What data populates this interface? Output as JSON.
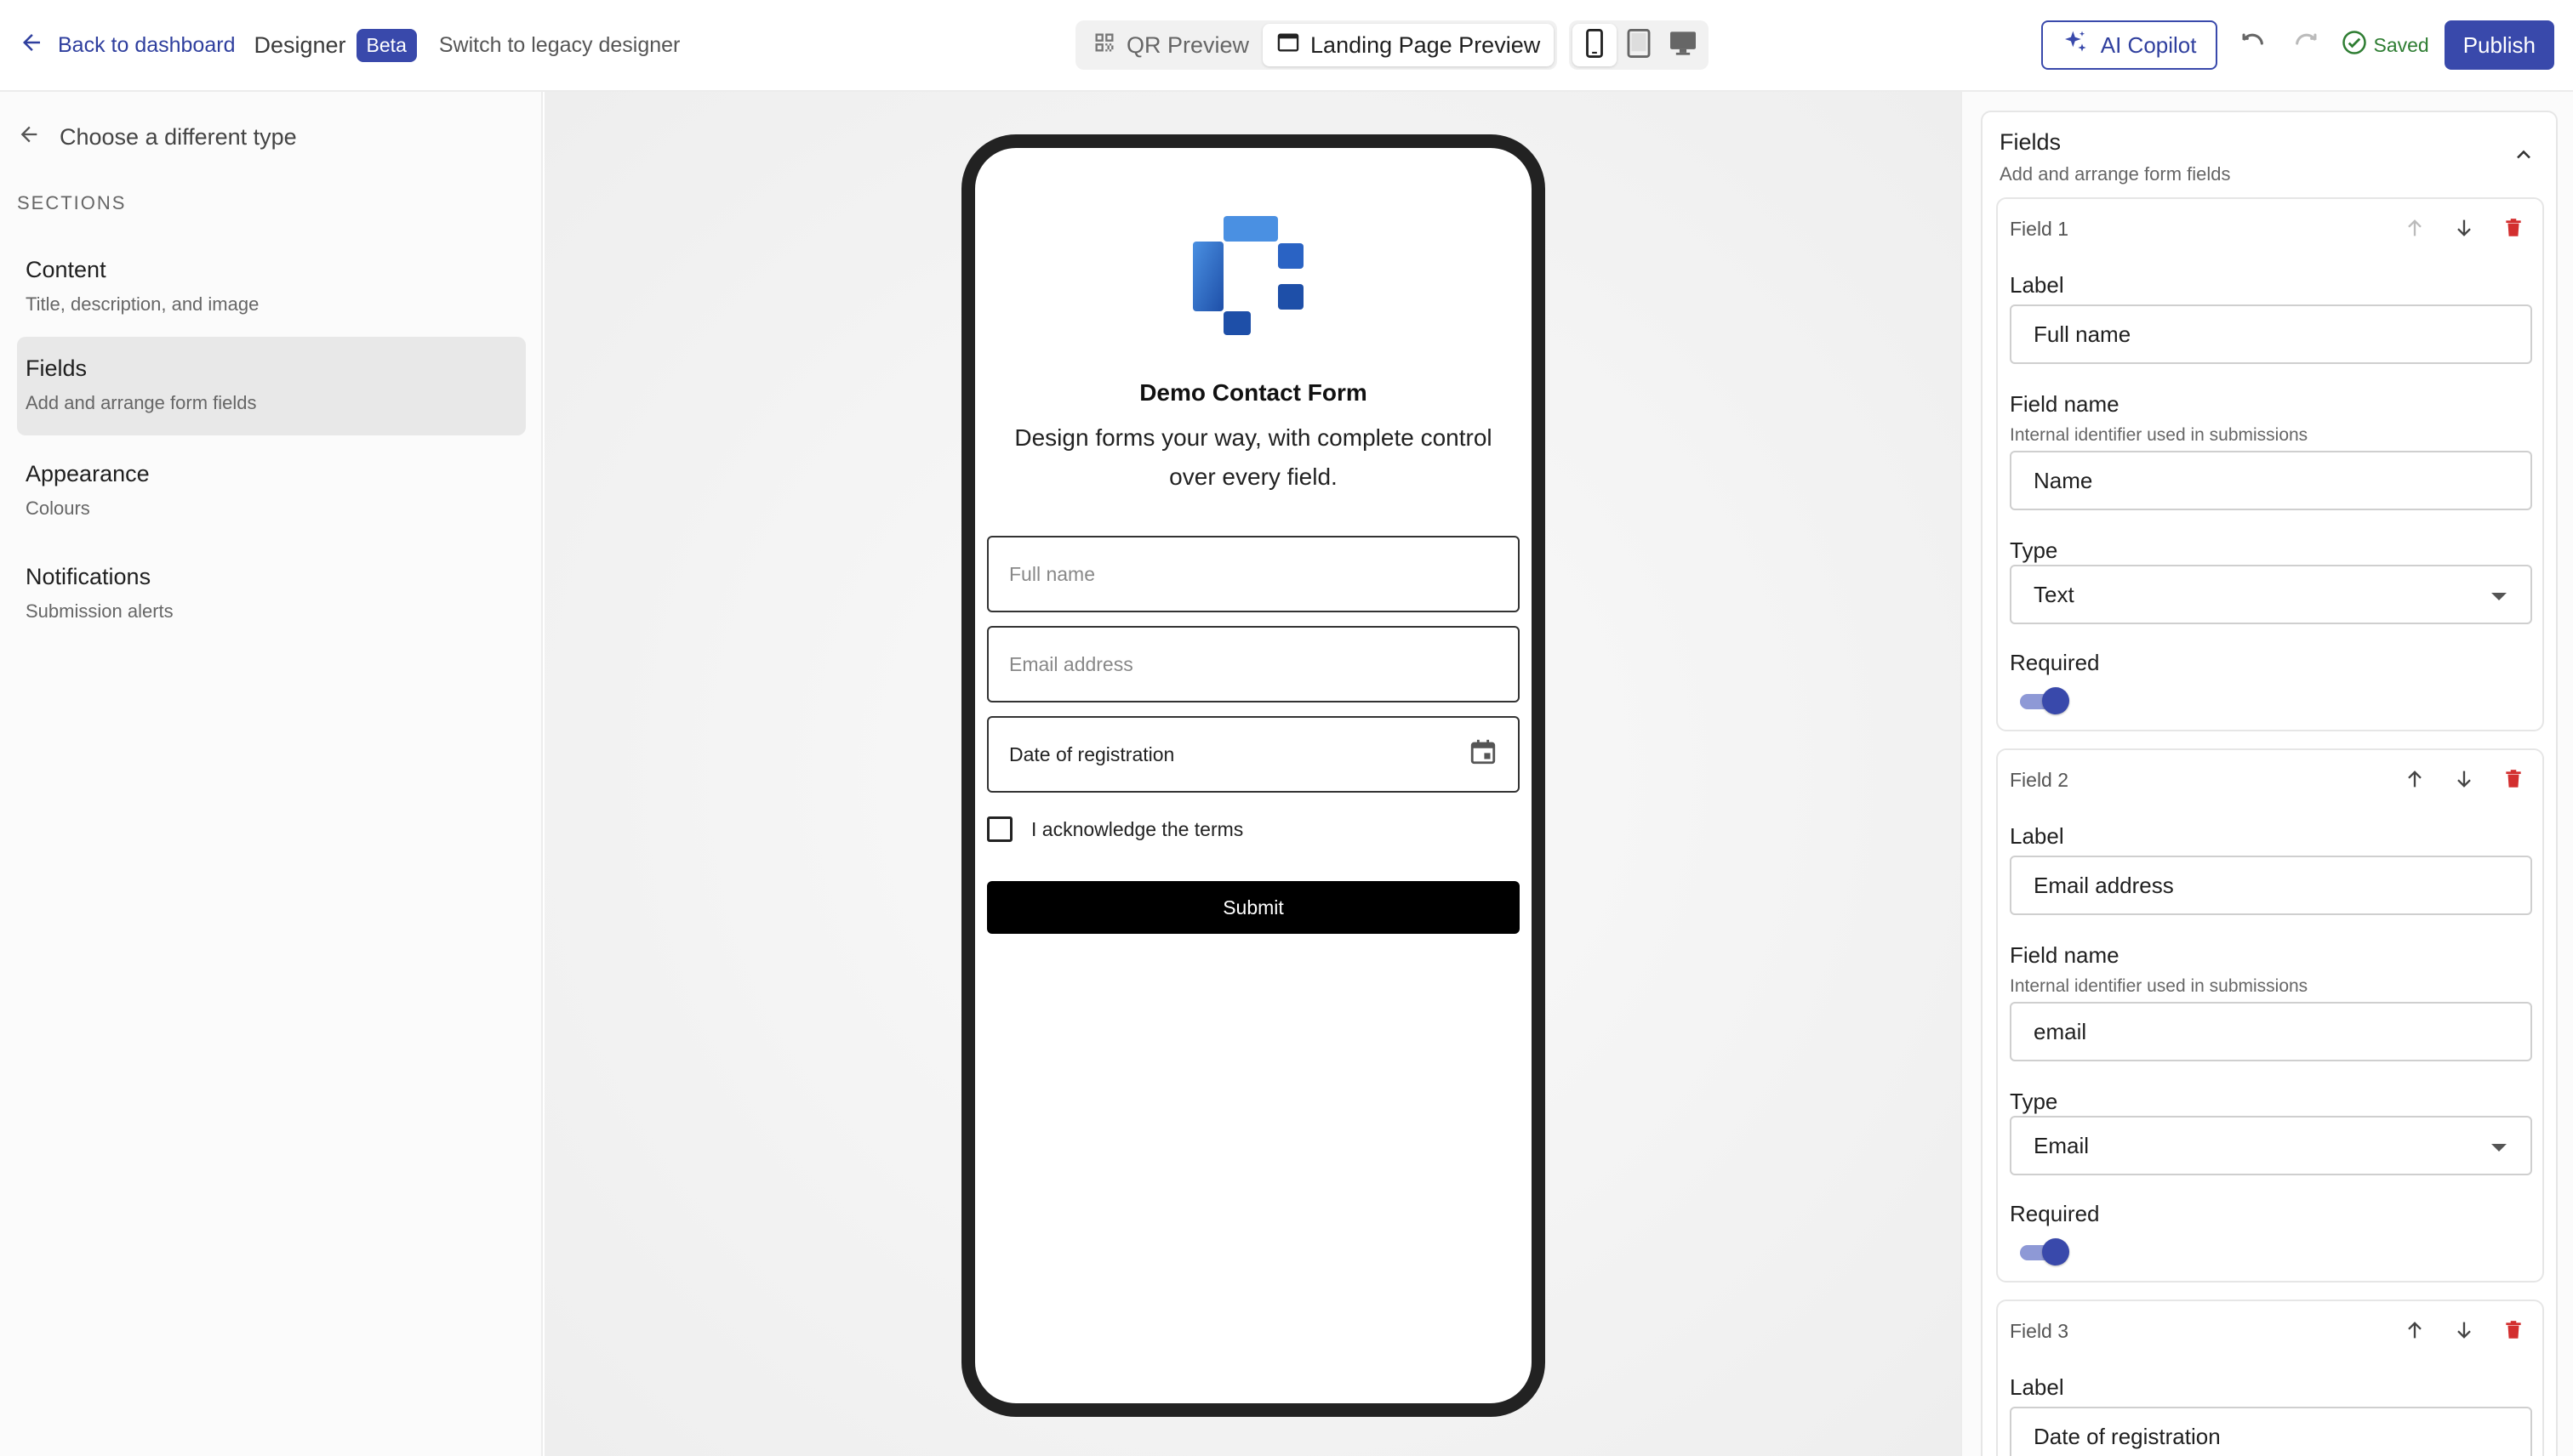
{
  "topbar": {
    "back_label": "Back to dashboard",
    "designer_label": "Designer",
    "beta_badge": "Beta",
    "legacy_label": "Switch to legacy designer",
    "qr_preview_label": "QR Preview",
    "landing_preview_label": "Landing Page Preview",
    "copilot_label": "AI Copilot",
    "saved_label": "Saved",
    "publish_label": "Publish"
  },
  "sidebar": {
    "choose_type_label": "Choose a different type",
    "sections_label": "SECTIONS",
    "items": [
      {
        "title": "Content",
        "subtitle": "Title, description, and image"
      },
      {
        "title": "Fields",
        "subtitle": "Add and arrange form fields"
      },
      {
        "title": "Appearance",
        "subtitle": "Colours"
      },
      {
        "title": "Notifications",
        "subtitle": "Submission alerts"
      }
    ]
  },
  "preview": {
    "title": "Demo Contact Form",
    "description": "Design forms your way, with complete control over every field.",
    "full_name_placeholder": "Full name",
    "email_placeholder": "Email address",
    "date_label": "Date of registration",
    "checkbox_label": "I acknowledge the terms",
    "submit_label": "Submit"
  },
  "panel": {
    "title": "Fields",
    "subtitle": "Add and arrange form fields",
    "label_caption": "Label",
    "field_name_caption": "Field name",
    "field_name_help": "Internal identifier used in submissions",
    "type_caption": "Type",
    "required_caption": "Required",
    "fields": [
      {
        "number": "Field 1",
        "label": "Full name",
        "name": "Name",
        "type": "Text",
        "required": true
      },
      {
        "number": "Field 2",
        "label": "Email address",
        "name": "email",
        "type": "Email",
        "required": true
      },
      {
        "number": "Field 3",
        "label": "Date of registration"
      }
    ]
  },
  "colors": {
    "accent": "#3949ab",
    "danger": "#d32f2f",
    "success": "#2e7d32"
  }
}
